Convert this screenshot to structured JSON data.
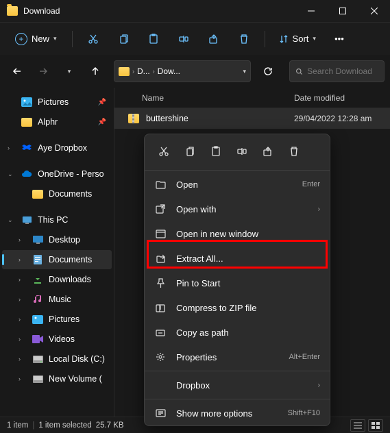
{
  "window": {
    "title": "Download"
  },
  "toolbar": {
    "new_label": "New",
    "sort_label": "Sort"
  },
  "address": {
    "crumb1": "D...",
    "crumb2": "Dow..."
  },
  "search": {
    "placeholder": "Search Download"
  },
  "columns": {
    "name": "Name",
    "date": "Date modified"
  },
  "sidebar": {
    "pictures": "Pictures",
    "alphr": "Alphr",
    "aye": "Aye Dropbox",
    "onedrive": "OneDrive - Perso",
    "documents": "Documents",
    "thispc": "This PC",
    "desktop": "Desktop",
    "documents2": "Documents",
    "downloads": "Downloads",
    "music": "Music",
    "pictures2": "Pictures",
    "videos": "Videos",
    "localdisk": "Local Disk (C:)",
    "newvolume": "New Volume ("
  },
  "file": {
    "name": "buttershine",
    "date": "29/04/2022 12:28 am"
  },
  "ctx": {
    "open": "Open",
    "open_short": "Enter",
    "openwith": "Open with",
    "newwindow": "Open in new window",
    "extract": "Extract All...",
    "pin": "Pin to Start",
    "compress": "Compress to ZIP file",
    "copypath": "Copy as path",
    "properties": "Properties",
    "properties_short": "Alt+Enter",
    "dropbox": "Dropbox",
    "more": "Show more options",
    "more_short": "Shift+F10"
  },
  "status": {
    "count": "1 item",
    "selected": "1 item selected",
    "size": "25.7 KB"
  }
}
